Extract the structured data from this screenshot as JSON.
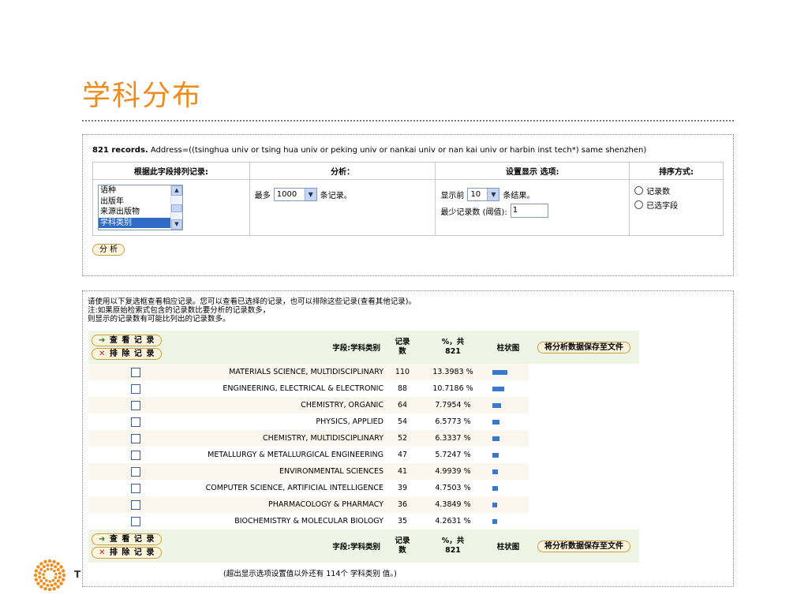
{
  "title": "学科分布",
  "summary": {
    "records": "821 records.",
    "query": "Address=((tsinghua univ or tsing hua univ or peking univ or nankai univ or nan kai univ or harbin inst tech*) same shenzhen)"
  },
  "settings": {
    "headers": [
      "根据此字段排列记录:",
      "分析：",
      "设置显示 选项:",
      "排序方式:"
    ],
    "field_options": [
      "语种",
      "出版年",
      "来源出版物",
      "学科类别"
    ],
    "selected_field": "学科类别",
    "analyze_prefix": "最多",
    "analyze_value": "1000",
    "analyze_suffix": "条记录。",
    "show_prefix": "显示前",
    "show_value": "10",
    "show_suffix": "条结果。",
    "min_label": "最少记录数 (阈值):",
    "min_value": "1",
    "sort_options": [
      "记录数",
      "已选字段"
    ],
    "analyze_button": "分 析"
  },
  "notes": [
    "请使用以下复选框查看相应记录。您可以查看已选择的记录，也可以排除这些记录(查看其他记录)。",
    "注:如果原始检索式包含的记录数比要分析的记录数多，",
    "则显示的记录数有可能比列出的记录数多。"
  ],
  "results": {
    "view_button": "查 看 记 录",
    "exclude_button": "排 除 记 录",
    "col_field": "字段:学科类别",
    "col_count": "记录\n数",
    "col_percent": "%，共\n821",
    "col_chart": "柱状图",
    "save_button": "将分析数据保存至文件",
    "rows": [
      {
        "name": "MATERIALS SCIENCE, MULTIDISCIPLINARY",
        "count": "110",
        "percent": "13.3983 %",
        "frac": 0.134
      },
      {
        "name": "ENGINEERING, ELECTRICAL & ELECTRONIC",
        "count": "88",
        "percent": "10.7186 %",
        "frac": 0.1072
      },
      {
        "name": "CHEMISTRY, ORGANIC",
        "count": "64",
        "percent": "7.7954 %",
        "frac": 0.078
      },
      {
        "name": "PHYSICS, APPLIED",
        "count": "54",
        "percent": "6.5773 %",
        "frac": 0.0658
      },
      {
        "name": "CHEMISTRY, MULTIDISCIPLINARY",
        "count": "52",
        "percent": "6.3337 %",
        "frac": 0.0633
      },
      {
        "name": "METALLURGY & METALLURGICAL ENGINEERING",
        "count": "47",
        "percent": "5.7247 %",
        "frac": 0.0572
      },
      {
        "name": "ENVIRONMENTAL SCIENCES",
        "count": "41",
        "percent": "4.9939 %",
        "frac": 0.0499
      },
      {
        "name": "COMPUTER SCIENCE, ARTIFICIAL INTELLIGENCE",
        "count": "39",
        "percent": "4.7503 %",
        "frac": 0.0475
      },
      {
        "name": "PHARMACOLOGY & PHARMACY",
        "count": "36",
        "percent": "4.3849 %",
        "frac": 0.0438
      },
      {
        "name": "BIOCHEMISTRY & MOLECULAR BIOLOGY",
        "count": "35",
        "percent": "4.2631 %",
        "frac": 0.0426
      }
    ]
  },
  "footnote": "(超出显示选项设置值以外还有 114个 学科类别 值。)",
  "logo_letter": "T",
  "colors": {
    "title": "#f08c1e",
    "bar": "#3d78c8",
    "header_bg": "#eef5e4",
    "row_alt": "#fbf7ee"
  }
}
